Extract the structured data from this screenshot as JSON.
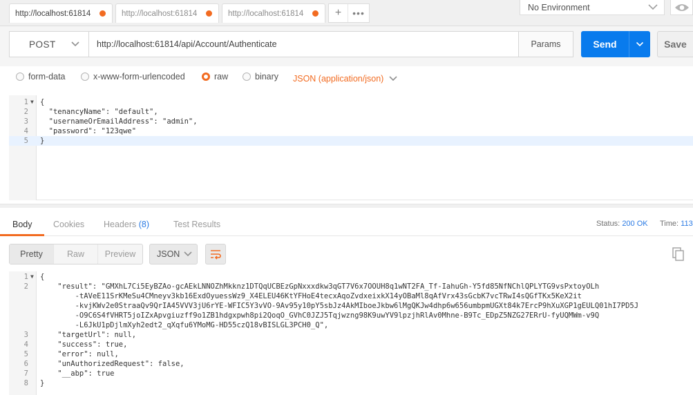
{
  "tabs": [
    {
      "label": "http://localhost:61814",
      "active": true
    },
    {
      "label": "http://localhost:61814",
      "active": false
    },
    {
      "label": "http://localhost:61814",
      "active": false
    }
  ],
  "environment": {
    "selected": "No Environment"
  },
  "request": {
    "method": "POST",
    "url": "http://localhost:61814/api/Account/Authenticate",
    "params_label": "Params",
    "send_label": "Send",
    "save_label": "Save"
  },
  "body_types": {
    "form_data": "form-data",
    "urlencoded": "x-www-form-urlencoded",
    "raw": "raw",
    "binary": "binary",
    "selected": "raw",
    "content_type": "JSON (application/json)"
  },
  "request_body_lines": [
    {
      "n": "1",
      "text": "{"
    },
    {
      "n": "2",
      "text": "  \"tenancyName\": \"default\","
    },
    {
      "n": "3",
      "text": "  \"usernameOrEmailAddress\": \"admin\","
    },
    {
      "n": "4",
      "text": "  \"password\": \"123qwe\""
    },
    {
      "n": "5",
      "text": "}"
    }
  ],
  "response_tabs": {
    "body": "Body",
    "cookies": "Cookies",
    "headers": "Headers",
    "headers_count": "(8)",
    "test_results": "Test Results"
  },
  "response_meta": {
    "status_label": "Status:",
    "status_value": "200 OK",
    "time_label": "Time:",
    "time_value": "113"
  },
  "response_toolbar": {
    "pretty": "Pretty",
    "raw": "Raw",
    "preview": "Preview",
    "format": "JSON"
  },
  "response_body_lines": [
    {
      "n": "1",
      "text": "{"
    },
    {
      "n": "2",
      "text": "    \"result\": \"GMXhL7Ci5EyBZAo-gcAEkLNNOZhMkknz1DTQqUCBEzGpNxxxdkw3qGT7V6x7OOUH8q1wNT2FA_Tf-IahuGh-Y5fd85NfNChlQPLYTG9vsPxtoyOLh"
    },
    {
      "n": "",
      "text": "        -tAVeE11SrKMeSu4CMneyv3kb16ExdOyuessWz9_X4ELEU46KtYFHoE4tecxAqoZvdxeixkX14yOBaMl8qAfVrx43sGcbK7vcTRwI4sQGfTKx5KeX2it"
    },
    {
      "n": "",
      "text": "        -kvjKWv2e0StraaQv9QrIA45VVV3jU6rYE-WFIC5Y3vVO-9Av95y10pY5sbJz4AkMIboeJkbw6lMgQKJw4dhp6w656umbpmUGXt84k7ErcP9hXuXGP1gEULQ01hI7PD5J"
    },
    {
      "n": "",
      "text": "        -O9C6S4fVHRT5joIZxApvgiuzff9o1ZB1hdgxpwh8pi2QoqO_GVhC0JZJ5Tqjwzng98K9uwYV9lpzjhRlAv0Mhne-B9Tc_EDpZ5NZG27ERrU-fyUQMWm-v9Q"
    },
    {
      "n": "",
      "text": "        -L6JkU1pDjlmXyh2edt2_qXqfu6YMoMG-HD55czQ18vBISLGL3PCH0_Q\","
    },
    {
      "n": "3",
      "text": "    \"targetUrl\": null,"
    },
    {
      "n": "4",
      "text": "    \"success\": true,"
    },
    {
      "n": "5",
      "text": "    \"error\": null,"
    },
    {
      "n": "6",
      "text": "    \"unAuthorizedRequest\": false,"
    },
    {
      "n": "7",
      "text": "    \"__abp\": true"
    },
    {
      "n": "8",
      "text": "}"
    }
  ],
  "colors": {
    "accent": "#f26b21",
    "send": "#097bed",
    "status_ok": "#2a7ae4"
  }
}
